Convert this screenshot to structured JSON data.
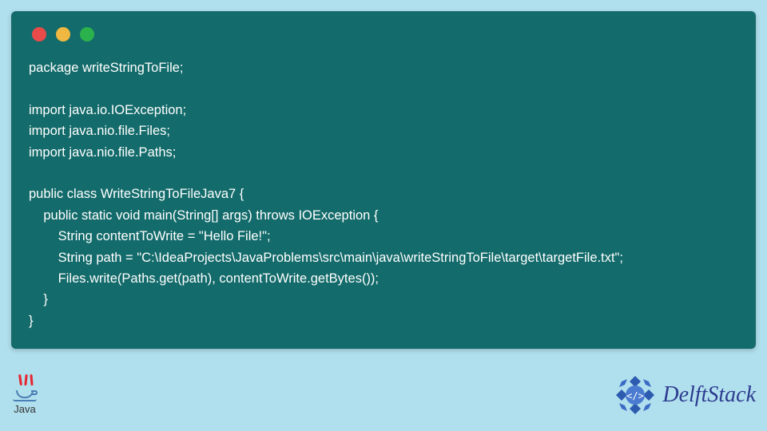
{
  "code": {
    "line1": "package writeStringToFile;",
    "line2": "",
    "line3": "import java.io.IOException;",
    "line4": "import java.nio.file.Files;",
    "line5": "import java.nio.file.Paths;",
    "line6": "",
    "line7": "public class WriteStringToFileJava7 {",
    "line8": "    public static void main(String[] args) throws IOException {",
    "line9": "        String contentToWrite = \"Hello File!\";",
    "line10": "        String path = \"C:\\IdeaProjects\\JavaProblems\\src\\main\\java\\writeStringToFile\\target\\targetFile.txt\";",
    "line11": "        Files.write(Paths.get(path), contentToWrite.getBytes());",
    "line12": "    }",
    "line13": "}"
  },
  "footer": {
    "java_label": "Java",
    "brand": "DelftStack"
  }
}
